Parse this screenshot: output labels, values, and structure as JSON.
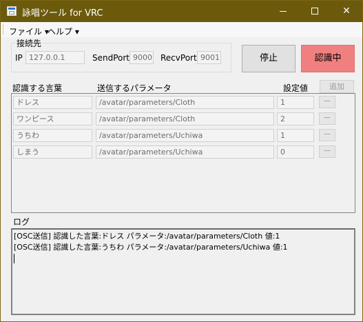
{
  "window": {
    "title": "詠唱ツール for VRC"
  },
  "caption": {
    "minimize": "─",
    "maximize": "☐",
    "close": "✕"
  },
  "menu": [
    "ファイル ▾",
    "ヘルプ ▾"
  ],
  "connection": {
    "group_title": "接続先",
    "ip_label": "IP",
    "ip_value": "127.0.0.1",
    "send_port_label": "SendPort",
    "send_port_value": "9000",
    "recv_port_label": "RecvPort",
    "recv_port_value": "9001"
  },
  "buttons": {
    "stop": "停止",
    "recognizing": "認識中",
    "add": "追加",
    "remove": "－"
  },
  "headers": {
    "word": "認識する言葉",
    "param": "送信するパラメータ",
    "value": "設定値"
  },
  "rows": [
    {
      "word": "ドレス",
      "param": "/avatar/parameters/Cloth",
      "value": "1"
    },
    {
      "word": "ワンピース",
      "param": "/avatar/parameters/Cloth",
      "value": "2"
    },
    {
      "word": "うちわ",
      "param": "/avatar/parameters/Uchiwa",
      "value": "1"
    },
    {
      "word": "しまう",
      "param": "/avatar/parameters/Uchiwa",
      "value": "0"
    }
  ],
  "log": {
    "label": "ログ",
    "lines": [
      "[OSC送信] 認識した言葉:ドレス  パラメータ:/avatar/parameters/Cloth  値:1",
      "[OSC送信] 認識した言葉:うちわ  パラメータ:/avatar/parameters/Uchiwa  値:1"
    ]
  },
  "colors": {
    "titlebar": "#6b5a0c",
    "recognizing_button": "#f08080",
    "window_bg": "#f0f0f0"
  }
}
